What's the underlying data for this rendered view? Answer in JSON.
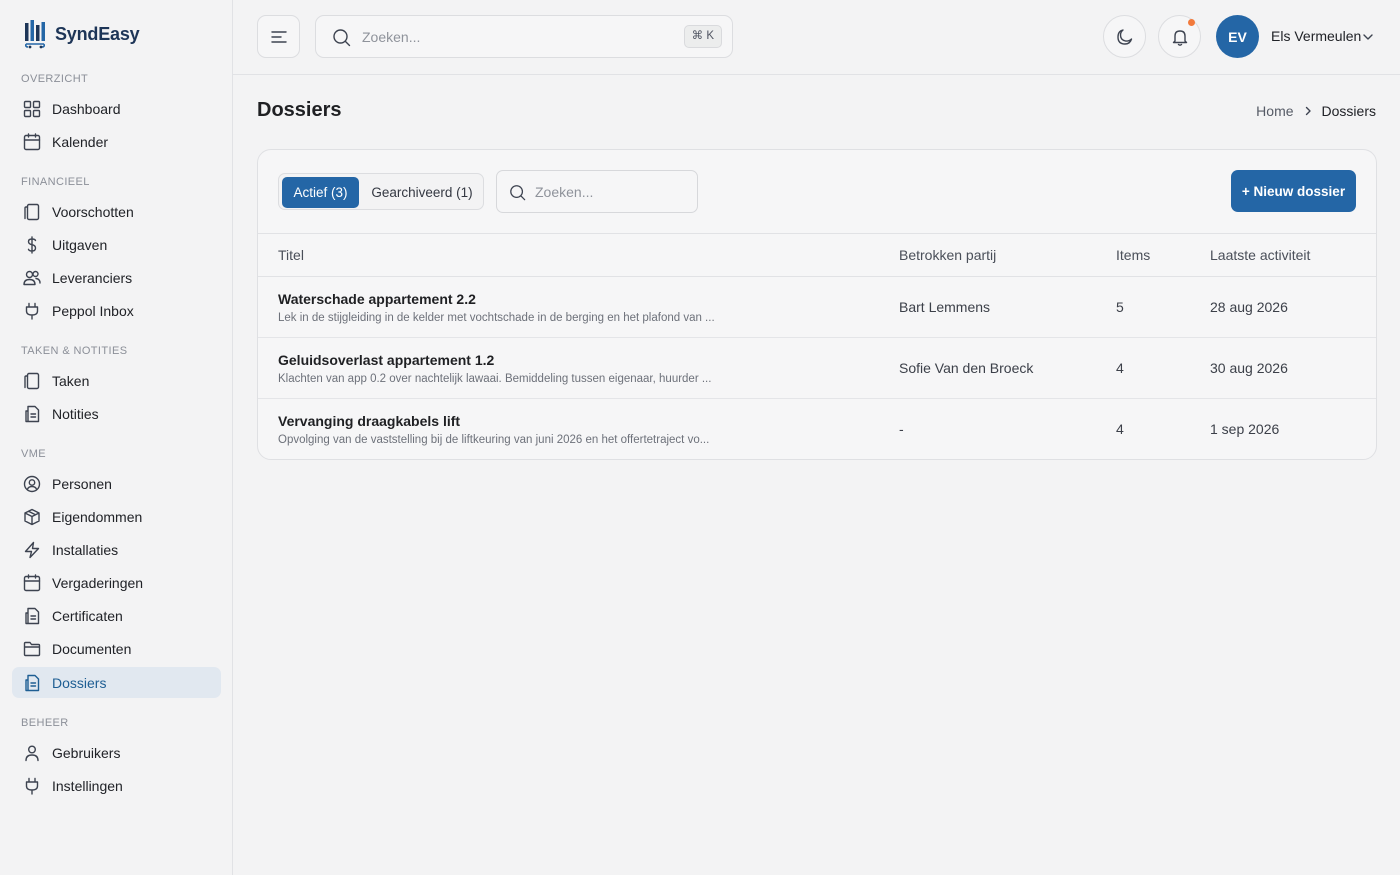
{
  "app": {
    "name": "SyndEasy"
  },
  "sidebar": {
    "sections": [
      {
        "label": "OVERZICHT",
        "items": [
          {
            "label": "Dashboard",
            "icon": "dashboard-icon"
          },
          {
            "label": "Kalender",
            "icon": "calendar-icon"
          }
        ]
      },
      {
        "label": "FINANCIEEL",
        "items": [
          {
            "label": "Voorschotten",
            "icon": "copy-icon"
          },
          {
            "label": "Uitgaven",
            "icon": "dollar-icon"
          },
          {
            "label": "Leveranciers",
            "icon": "users-icon"
          },
          {
            "label": "Peppol Inbox",
            "icon": "plug-icon"
          }
        ]
      },
      {
        "label": "TAKEN & NOTITIES",
        "items": [
          {
            "label": "Taken",
            "icon": "copy-icon"
          },
          {
            "label": "Notities",
            "icon": "document-icon"
          }
        ]
      },
      {
        "label": "VME",
        "items": [
          {
            "label": "Personen",
            "icon": "person-circle-icon"
          },
          {
            "label": "Eigendommen",
            "icon": "box-icon"
          },
          {
            "label": "Installaties",
            "icon": "bolt-icon"
          },
          {
            "label": "Vergaderingen",
            "icon": "calendar-icon"
          },
          {
            "label": "Certificaten",
            "icon": "document-icon"
          },
          {
            "label": "Documenten",
            "icon": "folder-icon"
          },
          {
            "label": "Dossiers",
            "icon": "document-icon",
            "active": true
          }
        ]
      },
      {
        "label": "BEHEER",
        "items": [
          {
            "label": "Gebruikers",
            "icon": "user-icon"
          },
          {
            "label": "Instellingen",
            "icon": "plug-icon"
          }
        ]
      }
    ]
  },
  "topbar": {
    "search_placeholder": "Zoeken...",
    "shortcut": "⌘ K",
    "user": {
      "initials": "EV",
      "name": "Els Vermeulen"
    },
    "has_notification": true
  },
  "page": {
    "title": "Dossiers",
    "breadcrumb": {
      "home": "Home",
      "current": "Dossiers"
    }
  },
  "dossiers": {
    "tabs": {
      "active": "Actief (3)",
      "archived": "Gearchiveerd (1)"
    },
    "search_placeholder": "Zoeken...",
    "new_button": "+ Nieuw dossier",
    "columns": {
      "title": "Titel",
      "party": "Betrokken partij",
      "items": "Items",
      "activity": "Laatste activiteit"
    },
    "rows": [
      {
        "title": "Waterschade appartement 2.2",
        "description": "Lek in de stijgleiding in de kelder met vochtschade in de berging en het plafond van ...",
        "party": "Bart Lemmens",
        "items": "5",
        "activity": "28 aug 2026"
      },
      {
        "title": "Geluidsoverlast appartement 1.2",
        "description": "Klachten van app 0.2 over nachtelijk lawaai. Bemiddeling tussen eigenaar, huurder ...",
        "party": "Sofie Van den Broeck",
        "items": "4",
        "activity": "30 aug 2026"
      },
      {
        "title": "Vervanging draagkabels lift",
        "description": "Opvolging van de vaststelling bij de liftkeuring van juni 2026 en het offertetraject vo...",
        "party": "-",
        "items": "4",
        "activity": "1 sep 2026"
      }
    ]
  },
  "colors": {
    "primary": "#2466a6",
    "brand_text": "#1d3557",
    "active_nav_bg": "#e1e8f0",
    "notification": "#f27a3c"
  }
}
